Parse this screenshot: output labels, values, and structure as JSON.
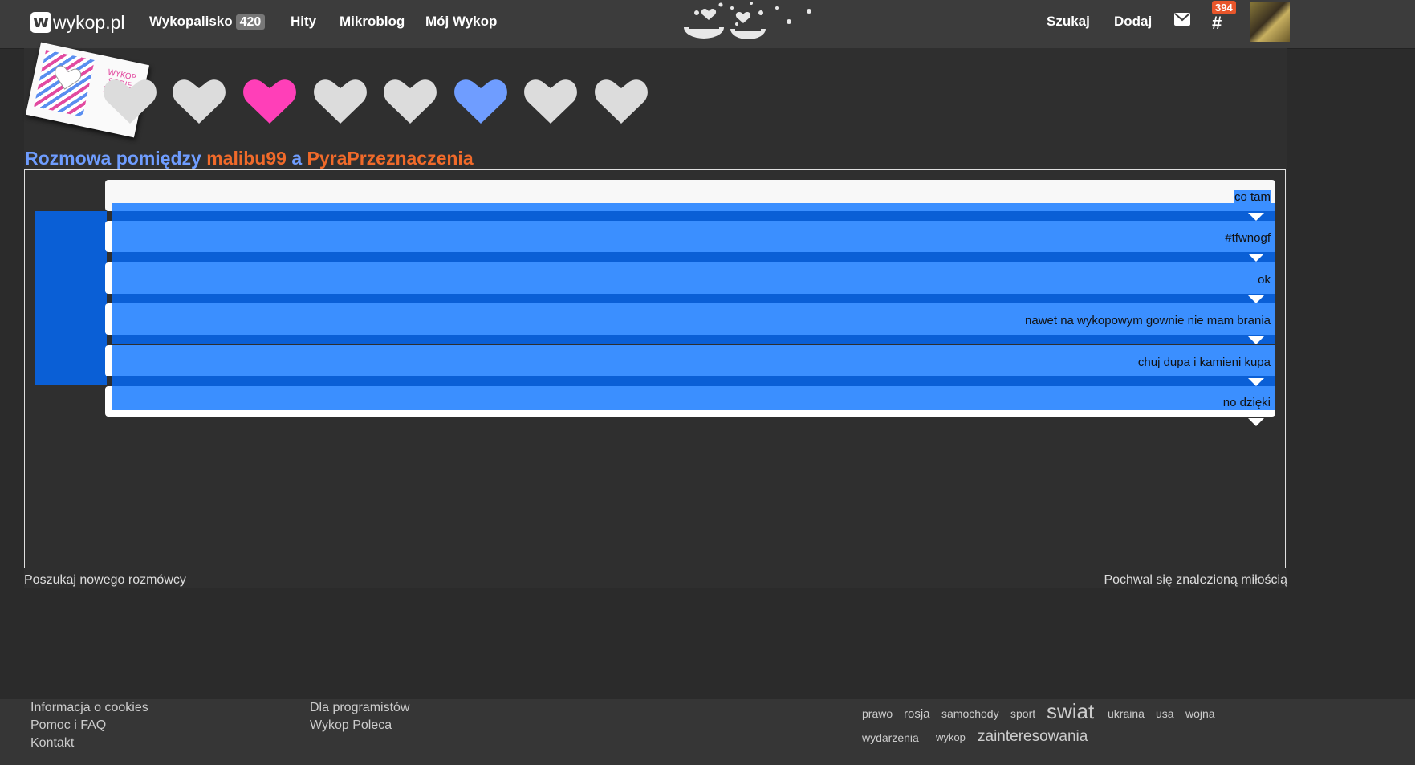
{
  "topbar": {
    "logo_text": "wykop.pl",
    "logo_letter": "w",
    "nav": {
      "wykopalisko": "Wykopalisko",
      "wykopalisko_count": "420",
      "hity": "Hity",
      "mikroblog": "Mikroblog",
      "moj_wykop": "Mój Wykop",
      "szukaj": "Szukaj",
      "dodaj": "Dodaj"
    },
    "notifications_count": "394",
    "hash_symbol": "#"
  },
  "note_card": {
    "text": "WYKOP SOBIE MIŁOŚĆ"
  },
  "hearts": [
    {
      "color": "#dcdcdc"
    },
    {
      "color": "#ff3fb8"
    },
    {
      "color": "#dcdcdc"
    },
    {
      "color": "#dcdcdc"
    },
    {
      "color": "#6f9dff"
    },
    {
      "color": "#dcdcdc"
    },
    {
      "color": "#dcdcdc"
    }
  ],
  "conversation": {
    "label": "Rozmowa pomiędzy",
    "user1": "malibu99",
    "separator": "a",
    "user2": "PyraPrzeznaczenia",
    "messages": [
      "co tam",
      "#tfwnogf",
      "ok",
      "nawet na wykopowym gownie nie mam brania",
      "chuj dupa i kamieni kupa",
      "no dzięki"
    ]
  },
  "actions": {
    "search_new": "Poszukaj nowego rozmówcy",
    "praise": "Pochwal się znalezioną miłością"
  },
  "footer": {
    "col1": [
      "Informacja o cookies",
      "Pomoc i FAQ",
      "Kontakt"
    ],
    "col2": [
      "Dla programistów",
      "Wykop Poleca"
    ],
    "tags_row1": [
      "prawo",
      "rosja",
      "samochody",
      "sport",
      "swiat",
      "ukraina",
      "usa",
      "wojna"
    ],
    "tags_row2": [
      "wydarzenia",
      "wykop",
      "zainteresowania"
    ]
  },
  "colors": {
    "accent_blue": "#3b8fff",
    "dark_blue": "#0a5fd6",
    "username_orange": "#f06a2a",
    "label_blue": "#6f9dff"
  }
}
